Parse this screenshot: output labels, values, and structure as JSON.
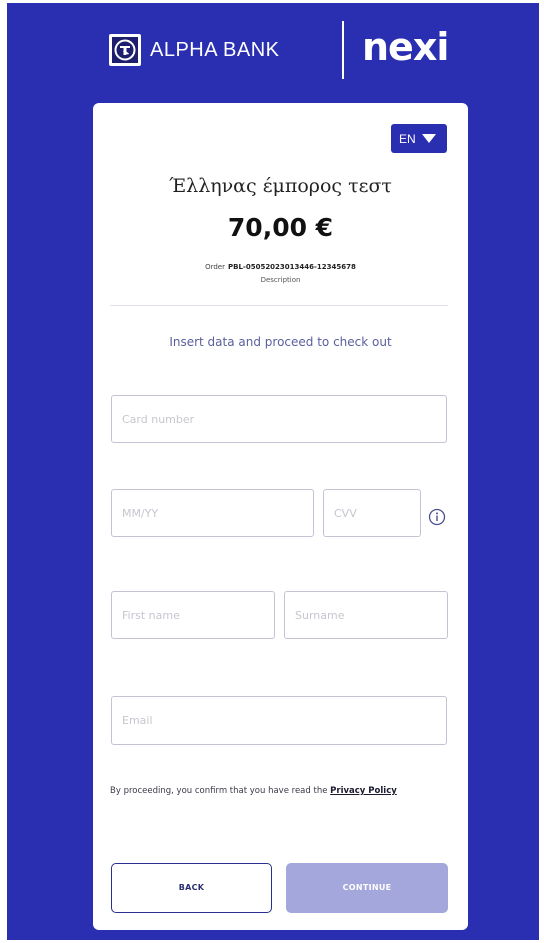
{
  "colors": {
    "background": "#2a2fb2",
    "card": "#ffffff",
    "accent": "#2a2fb2",
    "continue_disabled": "#a4a7db"
  },
  "header": {
    "alpha_bank_logo_icon": "alpha-bank-emblem-icon",
    "alpha_bank_text": "ALPHA BANK",
    "partner_logo_text": "nexi"
  },
  "card": {
    "language": {
      "label": "EN",
      "icon": "caret-down-icon"
    },
    "merchant_name": "Έλληνας έμπορος τεστ",
    "amount": "70,00 €",
    "order_label": "Order",
    "order_id": "PBL-05052023013446-12345678",
    "description": "Description",
    "instruction": "Insert data and proceed to check out"
  },
  "form": {
    "card_number": {
      "value": "",
      "placeholder": "Card number"
    },
    "expiry": {
      "value": "",
      "placeholder": "MM/YY"
    },
    "cvv": {
      "value": "",
      "placeholder": "CVV",
      "info_icon": "info-circle-icon"
    },
    "first_name": {
      "value": "",
      "placeholder": "First name"
    },
    "surname": {
      "value": "",
      "placeholder": "Surname"
    },
    "email": {
      "value": "",
      "placeholder": "Email"
    }
  },
  "legal": {
    "text": "By proceeding, you confirm that you have read the",
    "link": "Privacy Policy"
  },
  "buttons": {
    "back": "BACK",
    "continue": "CONTINUE"
  }
}
